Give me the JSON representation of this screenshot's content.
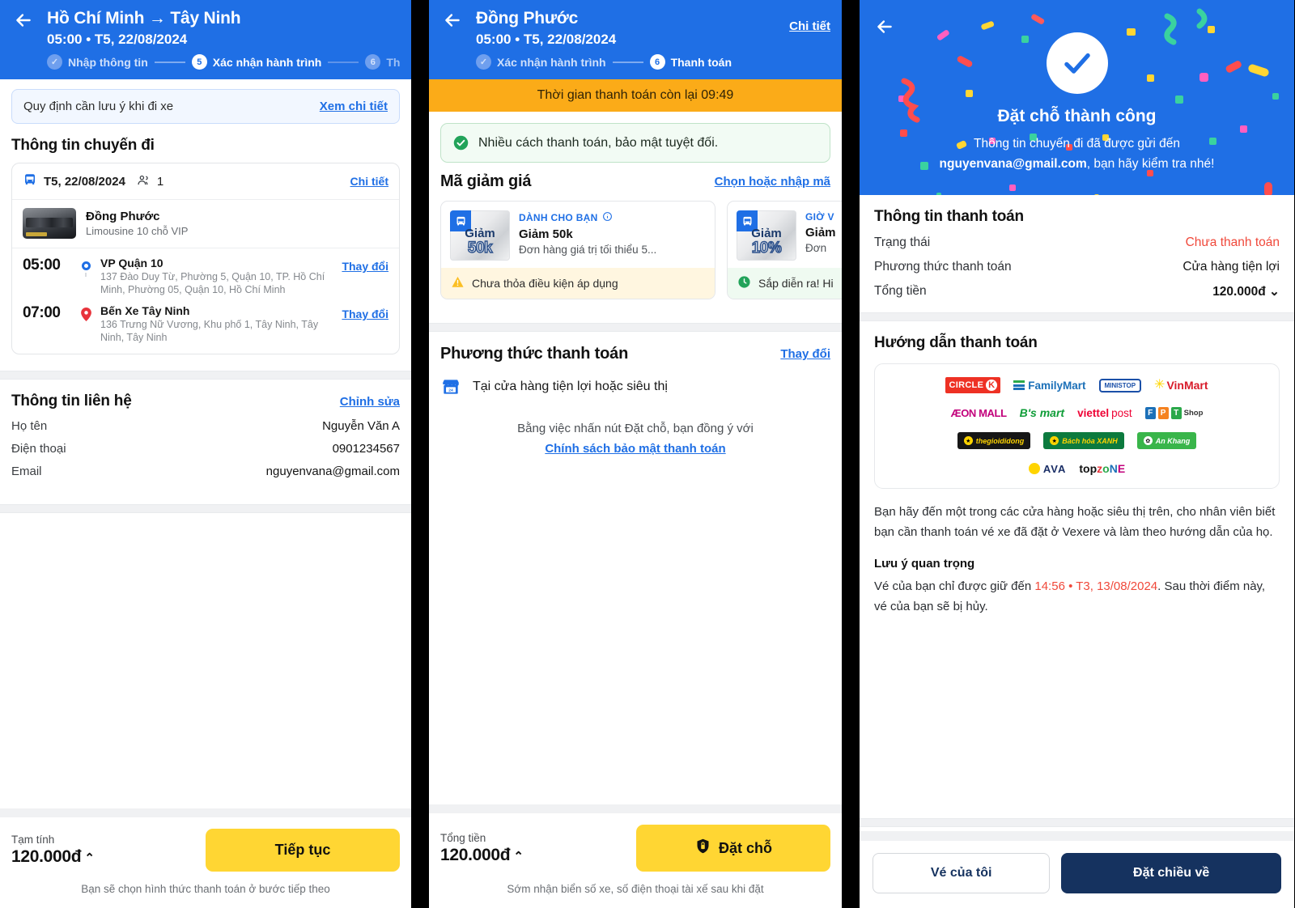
{
  "panel1": {
    "header": {
      "back_icon": "arrow-left-icon",
      "title": "Hồ Chí Minh → Tây Ninh",
      "subtitle": "05:00 • T5, 22/08/2024",
      "steps": [
        {
          "num": "✓",
          "label": "Nhập thông tin",
          "state": "done"
        },
        {
          "num": "5",
          "label": "Xác nhận hành trình",
          "state": "active"
        },
        {
          "num": "6",
          "label": "Thanh toán",
          "state": "todo"
        }
      ]
    },
    "notice": {
      "text": "Quy định cần lưu ý khi đi xe",
      "link": "Xem chi tiết"
    },
    "trip_section_title": "Thông tin chuyến đi",
    "trip_card": {
      "bus_icon": "bus-icon",
      "date": "T5, 22/08/2024",
      "passengers_icon": "passengers-icon",
      "passengers": "1",
      "detail_link": "Chi tiết",
      "operator_name": "Đồng Phước",
      "operator_type": "Limousine 10 chỗ VIP",
      "legs": [
        {
          "time": "05:00",
          "name": "VP Quận 10",
          "address": "137 Đào Duy Từ, Phường 5, Quận 10, TP. Hồ Chí Minh, Phường 05, Quận 10, Hồ Chí Minh",
          "change_link": "Thay đổi"
        },
        {
          "time": "07:00",
          "name": "Bến Xe Tây Ninh",
          "address": "136 Trưng Nữ Vương, Khu phố 1, Tây Ninh, Tây Ninh, Tây Ninh",
          "change_link": "Thay đổi"
        }
      ]
    },
    "contact": {
      "title": "Thông tin liên hệ",
      "edit_link": "Chỉnh sửa",
      "rows": [
        {
          "label": "Họ tên",
          "value": "Nguyễn Văn A"
        },
        {
          "label": "Điện thoại",
          "value": "0901234567"
        },
        {
          "label": "Email",
          "value": "nguyenvana@gmail.com"
        }
      ]
    },
    "bottom": {
      "total_label": "Tạm tính",
      "total_value": "120.000đ",
      "chevron": "⌃",
      "cta": "Tiếp tục",
      "note": "Bạn sẽ chọn hình thức thanh toán ở bước tiếp theo"
    }
  },
  "panel2": {
    "header": {
      "back_icon": "arrow-left-icon",
      "title": "Đồng Phước",
      "subtitle": "05:00 • T5, 22/08/2024",
      "detail_link": "Chi tiết",
      "steps": [
        {
          "num": "✓",
          "label": "Xác nhận hành trình",
          "state": "done"
        },
        {
          "num": "6",
          "label": "Thanh toán",
          "state": "active"
        }
      ]
    },
    "timer": "Thời gian thanh toán còn lại 09:49",
    "safe_banner": {
      "icon": "shield-check-icon",
      "text": "Nhiều cách thanh toán, bảo mật tuyệt đối."
    },
    "vouchers": {
      "title": "Mã giảm giá",
      "link": "Chọn hoặc nhập mã",
      "items": [
        {
          "img_line1": "Giảm",
          "img_line2": "50k",
          "tag": "DÀNH CHO BẠN",
          "tag_icon": "info-icon",
          "name": "Giảm 50k",
          "desc": "Đơn hàng giá trị tối thiểu 5...",
          "footer_icon": "warning-icon",
          "footer": "Chưa thỏa điều kiện áp dụng",
          "footer_state": "warn"
        },
        {
          "img_line1": "Giảm",
          "img_line2": "10%",
          "tag": "GIỜ V",
          "name": "Giảm",
          "desc": "Đơn",
          "footer_icon": "clock-icon",
          "footer": "Sắp diễn ra! Hi",
          "footer_state": "soon"
        }
      ]
    },
    "payment_method": {
      "title": "Phương thức thanh toán",
      "change_link": "Thay đổi",
      "icon": "store-icon",
      "selected": "Tại cửa hàng tiện lợi hoặc siêu thị"
    },
    "agreement": {
      "text": "Bằng việc nhấn nút Đặt chỗ, bạn đồng ý với",
      "link": "Chính sách bảo mật thanh toán"
    },
    "bottom": {
      "total_label": "Tổng tiền",
      "total_value": "120.000đ",
      "chevron": "⌃",
      "cta_icon": "shield-icon",
      "cta": "Đặt chỗ",
      "note": "Sớm nhận biển số xe, số điện thoại tài xế sau khi đặt"
    }
  },
  "panel3": {
    "back_icon": "arrow-left-icon",
    "success": {
      "check_icon": "check-circle-icon",
      "title": "Đặt chỗ thành công",
      "line1": "Thông tin chuyến đi đã được gửi đến",
      "email": "nguyenvana@gmail.com",
      "line2": ", bạn hãy kiểm tra nhé!"
    },
    "payment_info": {
      "title": "Thông tin thanh toán",
      "rows": [
        {
          "label": "Trạng thái",
          "value": "Chưa thanh toán",
          "style": "red"
        },
        {
          "label": "Phương thức thanh toán",
          "value": "Cửa hàng tiện lợi",
          "style": "normal"
        },
        {
          "label": "Tổng tiền",
          "value": "120.000đ",
          "style": "bold",
          "chevron": "⌄"
        }
      ]
    },
    "guide": {
      "title": "Hướng dẫn thanh toán",
      "logos": [
        [
          "CIRCLE K",
          "FamilyMart",
          "MINI STOP",
          "VinMart"
        ],
        [
          "ÆON MALL",
          "B's mart",
          "viettel post",
          "FPT Shop"
        ],
        [
          "thegioididong",
          "Bách hóa XANH",
          "An Khang"
        ],
        [
          "AVA",
          "topzone"
        ]
      ],
      "paragraph": "Bạn hãy đến một trong các cửa hàng hoặc siêu thị trên, cho nhân viên biết bạn cần thanh toán vé xe đã đặt ở Vexere và làm theo hướng dẫn của họ.",
      "note_title": "Lưu ý quan trọng",
      "note_prefix": "Vé của bạn chỉ được giữ đến ",
      "note_highlight": "14:56 • T3, 13/08/2024",
      "note_suffix": ". Sau thời điểm này, vé của bạn sẽ bị hủy."
    },
    "bottom": {
      "secondary": "Vé của tôi",
      "primary": "Đặt chiều về"
    }
  },
  "colors": {
    "brand_blue": "#1f6fe5",
    "accent_yellow": "#ffd633",
    "timer_orange": "#fbab18",
    "danger_red": "#f0483a",
    "navy": "#15325f"
  }
}
